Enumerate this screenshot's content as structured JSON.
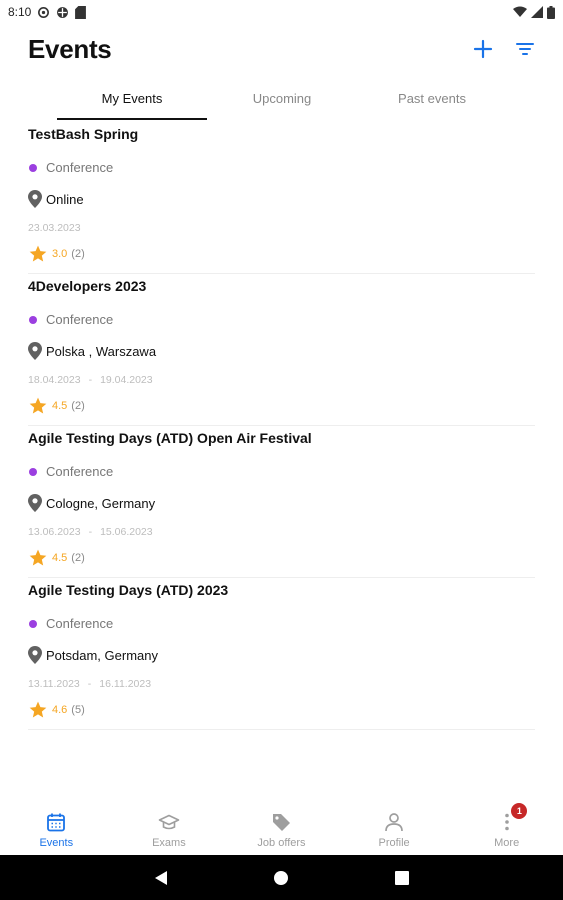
{
  "status_bar": {
    "time": "8:10",
    "left_icons": [
      "sync-icon",
      "vpn-icon",
      "sd-card-icon"
    ],
    "right_icons": [
      "wifi-icon",
      "signal-icon",
      "battery-icon"
    ]
  },
  "header": {
    "title": "Events",
    "actions": {
      "add_icon": "plus-icon",
      "filter_icon": "filter-icon"
    },
    "accent_color": "#1a73e8"
  },
  "tabs": [
    {
      "label": "My Events",
      "active": true
    },
    {
      "label": "Upcoming",
      "active": false
    },
    {
      "label": "Past events",
      "active": false
    }
  ],
  "events": [
    {
      "title": "TestBash Spring",
      "type": "Conference",
      "location": "Online",
      "start_date": "23.03.2023",
      "separator": "",
      "end_date": "",
      "rating": "3.0",
      "rating_count": "(2)"
    },
    {
      "title": "4Developers 2023",
      "type": "Conference",
      "location": "Polska , Warszawa",
      "start_date": "18.04.2023",
      "separator": "-",
      "end_date": "19.04.2023",
      "rating": "4.5",
      "rating_count": "(2)"
    },
    {
      "title": "Agile Testing Days (ATD) Open Air Festival",
      "type": "Conference",
      "location": "Cologne, Germany",
      "start_date": "13.06.2023",
      "separator": "-",
      "end_date": "15.06.2023",
      "rating": "4.5",
      "rating_count": "(2)"
    },
    {
      "title": "Agile Testing Days (ATD) 2023",
      "type": "Conference",
      "location": "Potsdam, Germany",
      "start_date": "13.11.2023",
      "separator": "-",
      "end_date": "16.11.2023",
      "rating": "4.6",
      "rating_count": "(5)"
    }
  ],
  "type_dot_color": "#9b3fe0",
  "rating_color": "#f5a623",
  "bottom_nav": [
    {
      "label": "Events",
      "icon": "calendar-icon",
      "active": true
    },
    {
      "label": "Exams",
      "icon": "graduation-cap-icon",
      "active": false
    },
    {
      "label": "Job offers",
      "icon": "tag-icon",
      "active": false
    },
    {
      "label": "Profile",
      "icon": "person-icon",
      "active": false
    },
    {
      "label": "More",
      "icon": "more-vertical-icon",
      "active": false,
      "badge": "1"
    }
  ],
  "system_nav": [
    "back-icon",
    "home-icon",
    "recents-icon"
  ]
}
